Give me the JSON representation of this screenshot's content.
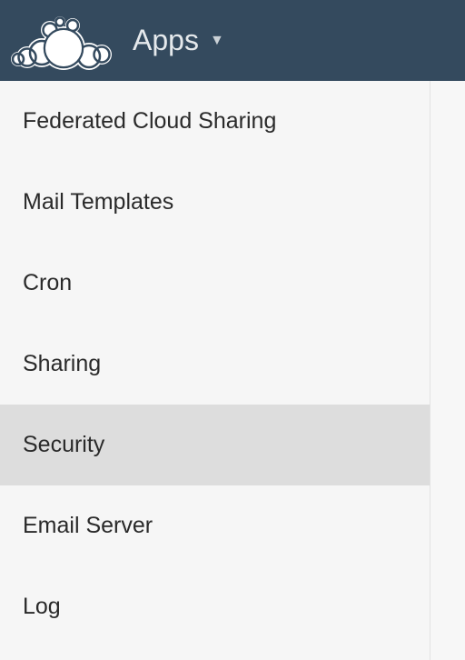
{
  "header": {
    "title": "Apps"
  },
  "sidebar": {
    "items": [
      {
        "label": "Federated Cloud Sharing",
        "active": false
      },
      {
        "label": "Mail Templates",
        "active": false
      },
      {
        "label": "Cron",
        "active": false
      },
      {
        "label": "Sharing",
        "active": false
      },
      {
        "label": "Security",
        "active": true
      },
      {
        "label": "Email Server",
        "active": false
      },
      {
        "label": "Log",
        "active": false
      }
    ]
  }
}
